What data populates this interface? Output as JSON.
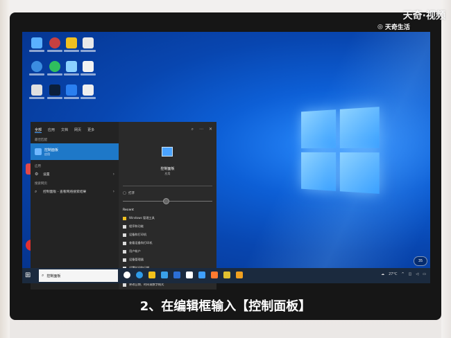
{
  "overlay": {
    "top_watermark": "天奇·视频",
    "logo_text": "天奇生活",
    "caption": "2、在编辑框输入【控制面板】"
  },
  "start_menu": {
    "tabs": [
      "全部",
      "应用",
      "文档",
      "网页",
      "更多"
    ],
    "best_match_heading": "最佳匹配",
    "best_match_title": "控制面板",
    "best_match_sub": "应用",
    "apps_heading": "应用",
    "apps_item": "设置",
    "web_heading": "搜索网页",
    "web_item": "控制面板 - 查看网络搜索结果",
    "right_title": "控制面板",
    "right_sub": "应用",
    "open_label": "打开",
    "recent_heading": "Recent",
    "recent_items": [
      "Windows 管理工具",
      "程序和功能",
      "设备和打印机",
      "查看设备和打印机",
      "用户帐户",
      "设备管理器",
      "设置时间和日期",
      "日期和时间",
      "更改日期、时间或数字格式"
    ]
  },
  "taskbar": {
    "search_value": "控制面板",
    "temperature": "27°C",
    "clock_badge": "35"
  },
  "colors": {
    "accent": "#1e78c8",
    "desktop": "#0d5fd6",
    "taskbar": "#1b2a3e"
  }
}
